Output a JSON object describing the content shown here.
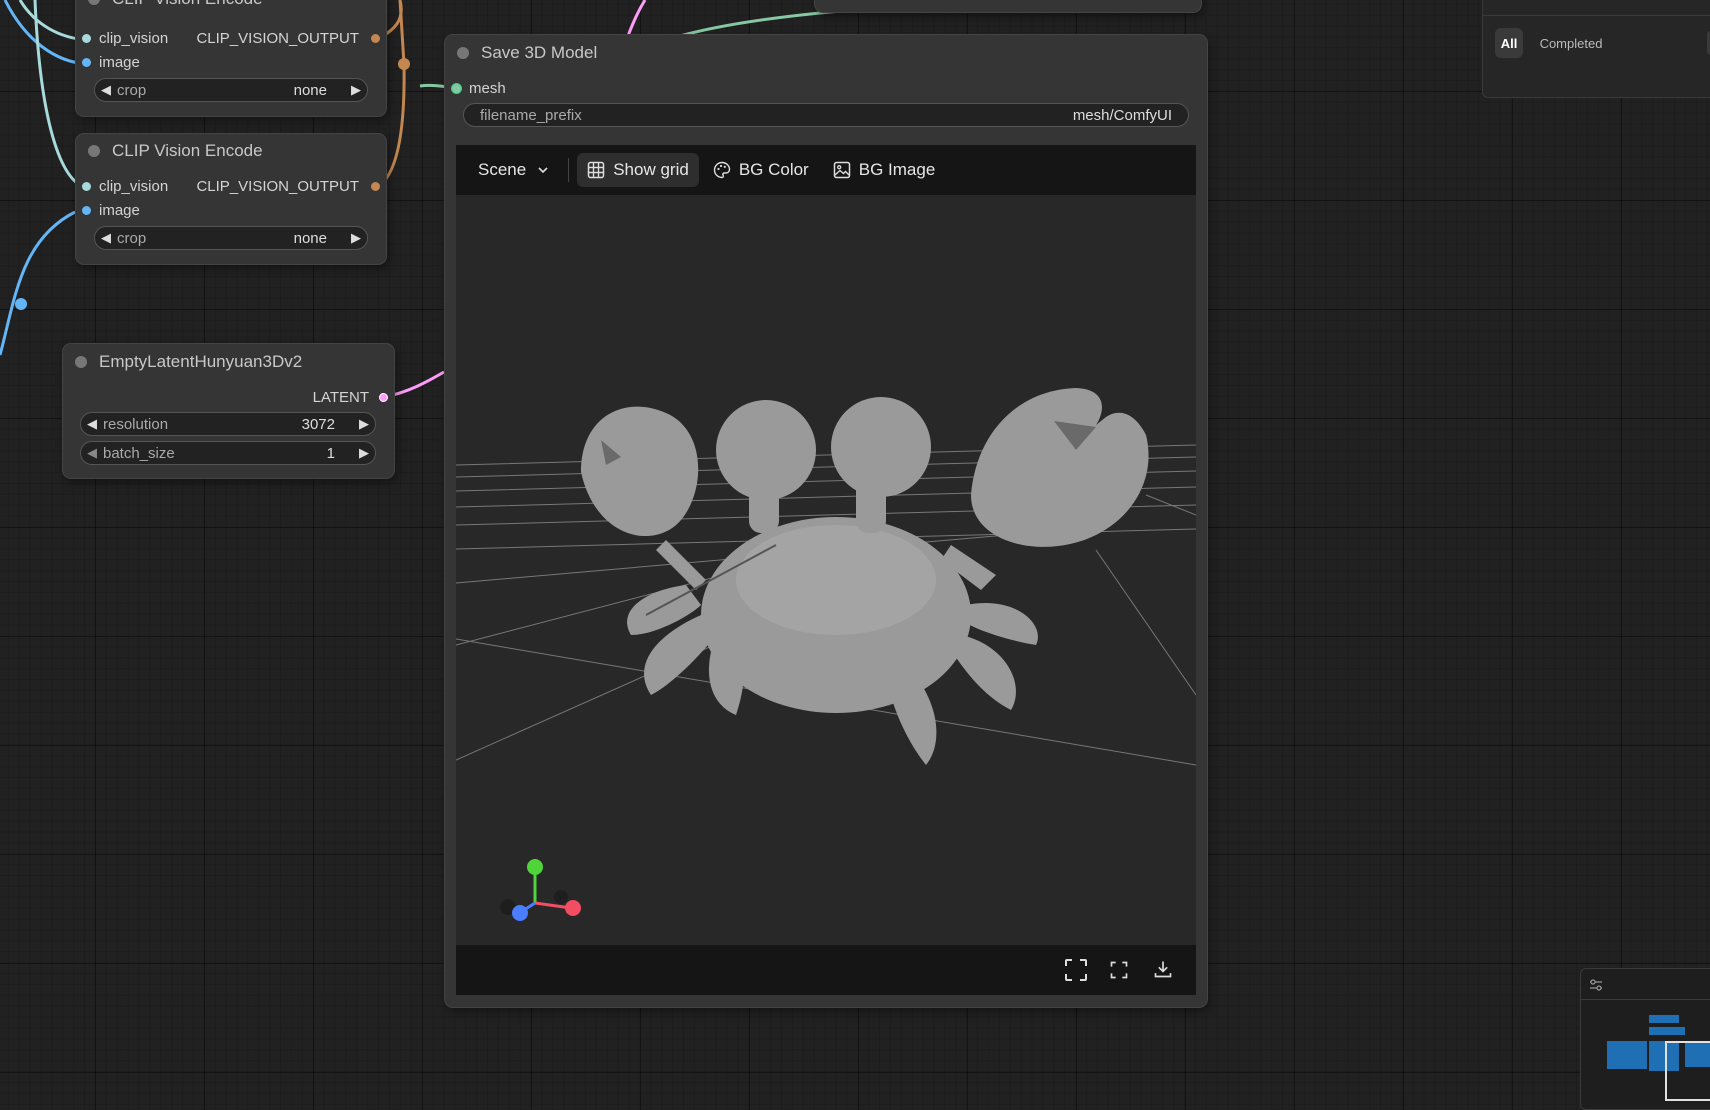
{
  "nodes": {
    "clip_vision_encode_1": {
      "title": "CLIP Vision Encode",
      "input_clip_vision": "clip_vision",
      "input_image": "image",
      "output": "CLIP_VISION_OUTPUT",
      "crop_label": "crop",
      "crop_value": "none"
    },
    "clip_vision_encode_2": {
      "title": "CLIP Vision Encode",
      "input_clip_vision": "clip_vision",
      "input_image": "image",
      "output": "CLIP_VISION_OUTPUT",
      "crop_label": "crop",
      "crop_value": "none"
    },
    "empty_latent": {
      "title": "EmptyLatentHunyuan3Dv2",
      "output": "LATENT",
      "resolution_label": "resolution",
      "resolution_value": "3072",
      "batch_size_label": "batch_size",
      "batch_size_value": "1"
    },
    "save_3d": {
      "title": "Save 3D Model",
      "input_mesh": "mesh",
      "filename_prefix_label": "filename_prefix",
      "filename_prefix_value": "mesh/ComfyUI"
    }
  },
  "viewer": {
    "toolbar": {
      "scene": "Scene",
      "show_grid": "Show grid",
      "bg_color": "BG Color",
      "bg_image": "BG Image"
    },
    "show_grid_active": true,
    "icons": [
      "chevron-down-icon",
      "grid-icon",
      "palette-icon",
      "image-icon",
      "fit-view-icon",
      "fullscreen-icon",
      "download-icon"
    ]
  },
  "queue_panel": {
    "tab_all": "All",
    "tab_completed": "Completed"
  },
  "colors": {
    "canvas_bg": "#212121",
    "node_bg": "#353535",
    "clip_vision_link": "#a8dadc",
    "image_link": "#64b5f6",
    "clip_vision_output_link": "#c48750",
    "latent_link": "#ff9cf9",
    "mesh_link": "#86c7a4",
    "axis_x": "#f24d62",
    "axis_y": "#4fd43a",
    "axis_z": "#4a7dff"
  }
}
